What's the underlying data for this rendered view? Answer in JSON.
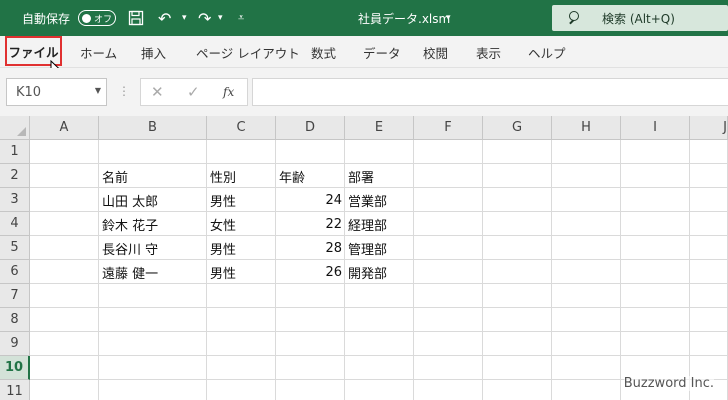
{
  "titlebar": {
    "autosave_label": "自動保存",
    "autosave_state": "オフ",
    "filename": "社員データ.xlsm",
    "search_placeholder": "検索 (Alt+Q)",
    "bg_color": "#217346"
  },
  "ribbon": {
    "tabs": [
      "ファイル",
      "ホーム",
      "挿入",
      "ページ レイアウト",
      "数式",
      "データ",
      "校閲",
      "表示",
      "ヘルプ"
    ],
    "active_tab": "ファイル",
    "highlight_color": "#e03030"
  },
  "formula_bar": {
    "name_box": "K10",
    "formula": ""
  },
  "sheet": {
    "columns": [
      "A",
      "B",
      "C",
      "D",
      "E",
      "F",
      "G",
      "H",
      "I",
      "J"
    ],
    "rows": [
      "1",
      "2",
      "3",
      "4",
      "5",
      "6",
      "7",
      "8",
      "9",
      "10",
      "11"
    ],
    "active_row": "10",
    "headers": [
      "名前",
      "性別",
      "年齢",
      "部署"
    ],
    "records": [
      {
        "name": "山田 太郎",
        "gender": "男性",
        "age": "24",
        "dept": "営業部"
      },
      {
        "name": "鈴木 花子",
        "gender": "女性",
        "age": "22",
        "dept": "経理部"
      },
      {
        "name": "長谷川 守",
        "gender": "男性",
        "age": "28",
        "dept": "管理部"
      },
      {
        "name": "遠藤 健一",
        "gender": "男性",
        "age": "26",
        "dept": "開発部"
      }
    ]
  },
  "watermark": "Buzzword Inc."
}
